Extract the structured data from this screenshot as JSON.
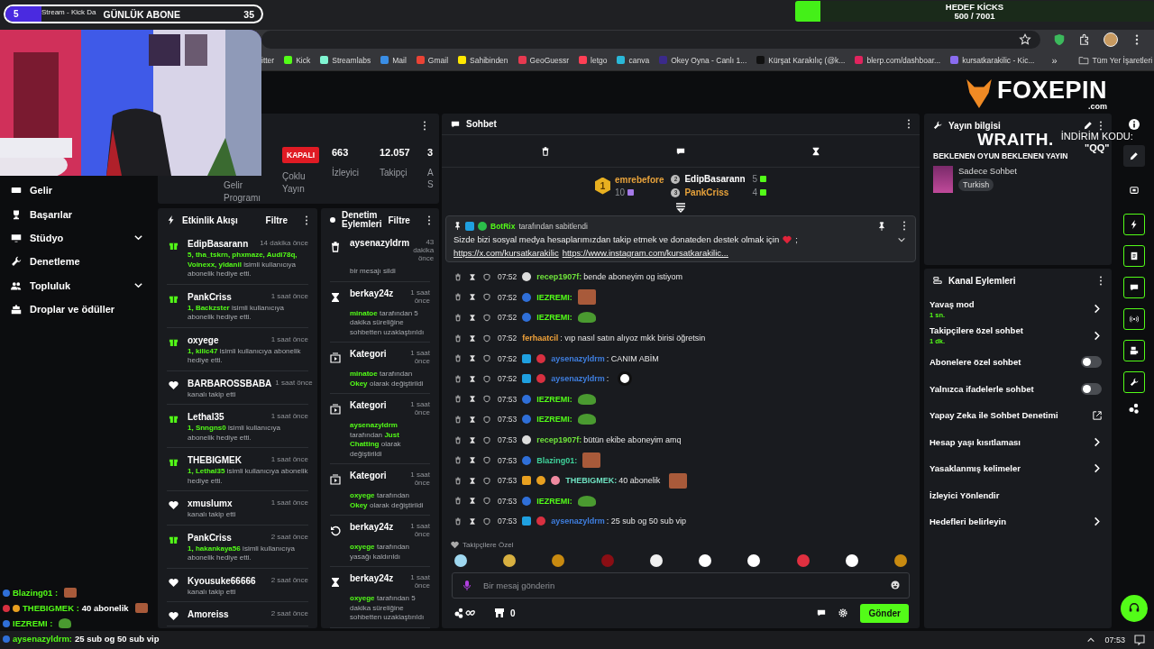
{
  "browser": {
    "tab_title": "Stream - Kick Da",
    "bookmarks": [
      {
        "label": "itter"
      },
      {
        "label": "Kick"
      },
      {
        "label": "Streamlabs"
      },
      {
        "label": "Mail"
      },
      {
        "label": "Gmail"
      },
      {
        "label": "Sahibinden"
      },
      {
        "label": "GeoGuessr"
      },
      {
        "label": "letgo"
      },
      {
        "label": "canva"
      },
      {
        "label": "Okey Oyna - Canlı 1..."
      },
      {
        "label": "Kürşat Karakılıç (@k..."
      },
      {
        "label": "blerp.com/dashboar..."
      },
      {
        "label": "kursatkarakilic - Kic..."
      }
    ],
    "more": "»",
    "all_bookmarks": "Tüm Yer İşaretleri"
  },
  "stream_overlays": {
    "sub_goal": {
      "count": "5",
      "label": "GÜNLÜK ABONE",
      "target": "35",
      "level": 0.14
    },
    "kick_goal": {
      "title": "HEDEF KİCKS",
      "progress": "500 / 7001",
      "level": 0.07
    },
    "sponsor_logo": {
      "name": "FOXEPIN",
      "domain": ".com"
    },
    "sponsor_banner": {
      "brand": "WRAITH.",
      "code_label": "İNDİRİM KODU:",
      "code": "\"QQ\""
    },
    "chat_overlay": [
      {
        "badges": [
          {
            "kind": "panda-blue"
          }
        ],
        "user": "Blazing01 :",
        "emote": {
          "kind": "face"
        }
      },
      {
        "badges": [
          {
            "kind": "panda-red"
          },
          {
            "kind": "coin"
          }
        ],
        "user": "THEBIGMEK :",
        "text": "40 abonelik",
        "emote": {
          "kind": "face"
        }
      },
      {
        "badges": [
          {
            "kind": "panda-blue"
          }
        ],
        "user": "IEZREMI :",
        "emote": {
          "kind": "frog"
        }
      },
      {
        "badges": [
          {
            "kind": "panda-blue"
          }
        ],
        "user": "aysenazyldrm:",
        "text": "25 sub og 50 sub vip"
      }
    ]
  },
  "sidebar": {
    "items": [
      {
        "label": "Gelir",
        "kind": "link"
      },
      {
        "label": "Başarılar",
        "kind": "link"
      },
      {
        "label": "Stüdyo",
        "kind": "group"
      },
      {
        "label": "Denetleme",
        "kind": "link"
      },
      {
        "label": "Topluluk",
        "kind": "group"
      },
      {
        "label": "Droplar ve ödüller",
        "kind": "link"
      }
    ]
  },
  "stream_stats": {
    "monetization": "Gelir Programı",
    "multistream": {
      "status": "KAPALI",
      "label": "Çoklu Yayın"
    },
    "stats": [
      {
        "value": "663",
        "label": "İzleyici"
      },
      {
        "value": "12.057",
        "label": "Takipçi"
      },
      {
        "value": "3",
        "label": "A S"
      }
    ]
  },
  "activity_feed": {
    "title": "Etkinlik Akışı",
    "filter": "Filtre",
    "items": [
      {
        "kind": "gift",
        "user": "EdipBasarann",
        "time": "14 dakika önce",
        "parts": [
          {
            "text": "5, tha_tskrn, phxmaze, Audi78q, Voinexx, yldanil",
            "hl": true
          },
          {
            "text": "isimli kullanıcıya abonelik hediye etti.",
            "hl": false
          }
        ]
      },
      {
        "kind": "gift",
        "user": "PankCriss",
        "time": "1 saat önce",
        "parts": [
          {
            "text": "1, Backzster",
            "hl": true
          },
          {
            "text": "isimli kullanıcıya abonelik hediye etti.",
            "hl": false
          }
        ]
      },
      {
        "kind": "gift",
        "user": "oxyege",
        "time": "1 saat önce",
        "parts": [
          {
            "text": "1, kilic47",
            "hl": true
          },
          {
            "text": "isimli kullanıcıya abonelik hediye etti.",
            "hl": false
          }
        ]
      },
      {
        "kind": "follow",
        "user": "BARBAROSSBABA",
        "time": "1 saat önce",
        "parts": [
          {
            "text": "kanalı takip etti",
            "hl": false
          }
        ]
      },
      {
        "kind": "gift",
        "user": "Lethal35",
        "time": "1 saat önce",
        "parts": [
          {
            "text": "1, Snngns0",
            "hl": true
          },
          {
            "text": "isimli kullanıcıya abonelik hediye etti.",
            "hl": false
          }
        ]
      },
      {
        "kind": "gift",
        "user": "THEBIGMEK",
        "time": "1 saat önce",
        "parts": [
          {
            "text": "1, Lethal35",
            "hl": true
          },
          {
            "text": "isimli kullanıcıya abonelik hediye etti.",
            "hl": false
          }
        ]
      },
      {
        "kind": "follow",
        "user": "xmuslumx",
        "time": "1 saat önce",
        "parts": [
          {
            "text": "kanalı takip etti",
            "hl": false
          }
        ]
      },
      {
        "kind": "gift",
        "user": "PankCriss",
        "time": "2 saat önce",
        "parts": [
          {
            "text": "1, hakankaya56",
            "hl": true
          },
          {
            "text": "isimli kullanıcıya abonelik hediye etti.",
            "hl": false
          }
        ]
      },
      {
        "kind": "follow",
        "user": "Kyousuke66666",
        "time": "2 saat önce",
        "parts": [
          {
            "text": "kanalı takip etti",
            "hl": false
          }
        ]
      },
      {
        "kind": "follow",
        "user": "Amoreiss",
        "time": "2 saat önce"
      }
    ]
  },
  "mod_actions": {
    "title": "Denetim Eylemleri",
    "filter": "Filtre",
    "items": [
      {
        "kind": "delete",
        "user": "aysenazyldrm",
        "time": "43 dakika önce",
        "parts": [
          {
            "text": "bir mesajı sildi",
            "hl": false
          }
        ]
      },
      {
        "kind": "timeout",
        "user": "berkay24z",
        "time": "1 saat önce",
        "parts": [
          {
            "text": "minatoe",
            "hl": true
          },
          {
            "text": "tarafından 5 dakika süreliğine sohbetten uzaklaştırıldı",
            "hl": false
          }
        ]
      },
      {
        "kind": "category",
        "user": "Kategori",
        "time": "1 saat önce",
        "parts": [
          {
            "text": "minatoe",
            "hl": true
          },
          {
            "text": "tarafından",
            "hl": false
          },
          {
            "text": "Okey",
            "hl": true
          },
          {
            "text": "olarak değiştirildi",
            "hl": false
          }
        ]
      },
      {
        "kind": "category",
        "user": "Kategori",
        "time": "1 saat önce",
        "parts": [
          {
            "text": "aysenazyldrm",
            "hl": true
          },
          {
            "text": "tarafından",
            "hl": false
          },
          {
            "text": "Just Chatting",
            "hl": true
          },
          {
            "text": "olarak değiştirildi",
            "hl": false
          }
        ]
      },
      {
        "kind": "category",
        "user": "Kategori",
        "time": "1 saat önce",
        "parts": [
          {
            "text": "oxyege",
            "hl": true
          },
          {
            "text": "tarafından",
            "hl": false
          },
          {
            "text": "Okey",
            "hl": true
          },
          {
            "text": "olarak değiştirildi",
            "hl": false
          }
        ]
      },
      {
        "kind": "unban",
        "user": "berkay24z",
        "time": "1 saat önce",
        "parts": [
          {
            "text": "oxyege",
            "hl": true
          },
          {
            "text": "tarafından yasağı kaldırıldı",
            "hl": false
          }
        ]
      },
      {
        "kind": "timeout",
        "user": "berkay24z",
        "time": "1 saat önce",
        "parts": [
          {
            "text": "oxyege",
            "hl": true
          },
          {
            "text": "tarafından 5 dakika süreliğine sohbetten uzaklaştırıldı",
            "hl": false
          }
        ]
      }
    ]
  },
  "chat": {
    "title": "Sohbet",
    "leaderboard": [
      {
        "rank": "1",
        "user": "emrebefore",
        "count": "10",
        "color": "#e8a33b"
      },
      {
        "rank": "2",
        "user": "EdipBasarann",
        "count": "5",
        "color": "#ffffff"
      },
      {
        "rank": "3",
        "user": "PankCriss",
        "count": "4",
        "color": "#e8a33b"
      }
    ],
    "pinned": {
      "by": "BotRix",
      "by_text": "tarafından sabitlendi",
      "text": "Sizde bizi sosyal medya hesaplarımızdan takip etmek ve donateden destek olmak için",
      "after_heart": ";",
      "links": [
        "https://x.com/kursatkarakilic",
        "https://www.instagram.com/kursatkarakilic..."
      ]
    },
    "messages": [
      {
        "time": "07:52",
        "badges": [
          {
            "kind": "panda-white"
          }
        ],
        "user": "recep1907f:",
        "color": "#6fe33b",
        "text": "bende aboneyim og istiyom"
      },
      {
        "time": "07:52",
        "badges": [
          {
            "kind": "panda-blue"
          }
        ],
        "user": "IEZREMI:",
        "color": "#53fc18",
        "emote": {
          "kind": "face"
        }
      },
      {
        "time": "07:52",
        "badges": [
          {
            "kind": "panda-blue"
          }
        ],
        "user": "IEZREMI:",
        "color": "#53fc18",
        "emote": {
          "kind": "frog"
        }
      },
      {
        "time": "07:52",
        "user": "ferhaatcil",
        "color": "#f2a33a",
        "text": ": vıp nasıl satın alıyoz mkk birisi öğretsin"
      },
      {
        "time": "07:52",
        "badges": [
          {
            "kind": "mod"
          },
          {
            "kind": "panda-red"
          }
        ],
        "user": "aysenazyldrm",
        "color": "#3f7fe0",
        "text": ": CANIM ABİM"
      },
      {
        "time": "07:52",
        "badges": [
          {
            "kind": "mod"
          },
          {
            "kind": "panda-red"
          }
        ],
        "user": "aysenazyldrm",
        "color": "#3f7fe0",
        "text": ":",
        "emote": {
          "kind": "panda"
        }
      },
      {
        "time": "07:53",
        "badges": [
          {
            "kind": "panda-blue"
          }
        ],
        "user": "IEZREMI:",
        "color": "#53fc18",
        "emote": {
          "kind": "frog"
        }
      },
      {
        "time": "07:53",
        "badges": [
          {
            "kind": "panda-blue"
          }
        ],
        "user": "IEZREMI:",
        "color": "#53fc18",
        "emote": {
          "kind": "frog"
        }
      },
      {
        "time": "07:53",
        "badges": [
          {
            "kind": "panda-white"
          }
        ],
        "user": "recep1907f:",
        "color": "#6fe33b",
        "text": "bütün ekibe aboneyim amq"
      },
      {
        "time": "07:53",
        "badges": [
          {
            "kind": "panda-blue"
          }
        ],
        "user": "Blazing01:",
        "color": "#3fd19a",
        "emote": {
          "kind": "face"
        }
      },
      {
        "time": "07:53",
        "badges": [
          {
            "kind": "crown"
          },
          {
            "kind": "coin"
          },
          {
            "kind": "gift"
          }
        ],
        "user": "THEBIGMEK:",
        "color": "#6ee0c0",
        "text": "40 abonelik",
        "emote": {
          "kind": "face"
        }
      },
      {
        "time": "07:53",
        "badges": [
          {
            "kind": "panda-blue"
          }
        ],
        "user": "IEZREMI:",
        "color": "#53fc18",
        "emote": {
          "kind": "frog"
        }
      },
      {
        "time": "07:53",
        "badges": [
          {
            "kind": "mod"
          },
          {
            "kind": "panda-red"
          }
        ],
        "user": "aysenazyldrm",
        "color": "#3f7fe0",
        "text": ": 25 sub og 50 sub vip"
      }
    ],
    "followers_only": "Takipçilere Özel",
    "emotes": [
      {
        "kind": "ice"
      },
      {
        "kind": "wings"
      },
      {
        "kind": "gold"
      },
      {
        "kind": "red"
      },
      {
        "kind": "face"
      },
      {
        "kind": "panda"
      },
      {
        "kind": "panda"
      },
      {
        "kind": "panda-red"
      },
      {
        "kind": "panda"
      },
      {
        "kind": "gold"
      }
    ],
    "input": {
      "placeholder": "Bir mesaj gönderin"
    },
    "points": "0",
    "send": "Gönder"
  },
  "stream_info": {
    "title": "Yayın bilgisi",
    "stream_title": "BEKLENEN OYUN BEKLENEN YAYIN",
    "category": "Sadece Sohbet",
    "tag": "Turkish"
  },
  "channel_actions": {
    "title": "Kanal Eylemleri",
    "items": [
      {
        "kind": "chevron",
        "label": "Yavaş mod",
        "value": "1 sn."
      },
      {
        "kind": "chevron",
        "label": "Takipçilere özel sohbet",
        "value": "1 dk."
      },
      {
        "kind": "toggle",
        "label": "Abonelere özel sohbet",
        "on": false
      },
      {
        "kind": "toggle",
        "label": "Yalnızca ifadelerle sohbet",
        "on": false
      },
      {
        "kind": "external",
        "label": "Yapay Zeka ile Sohbet Denetimi"
      },
      {
        "kind": "chevron",
        "label": "Hesap yaşı kısıtlaması"
      },
      {
        "kind": "chevron",
        "label": "Yasaklanmış kelimeler"
      },
      {
        "kind": "plain",
        "label": "İzleyici Yönlendir"
      },
      {
        "kind": "chevron",
        "label": "Hedefleri belirleyin"
      }
    ]
  },
  "taskbar": {
    "time": "07:53"
  }
}
